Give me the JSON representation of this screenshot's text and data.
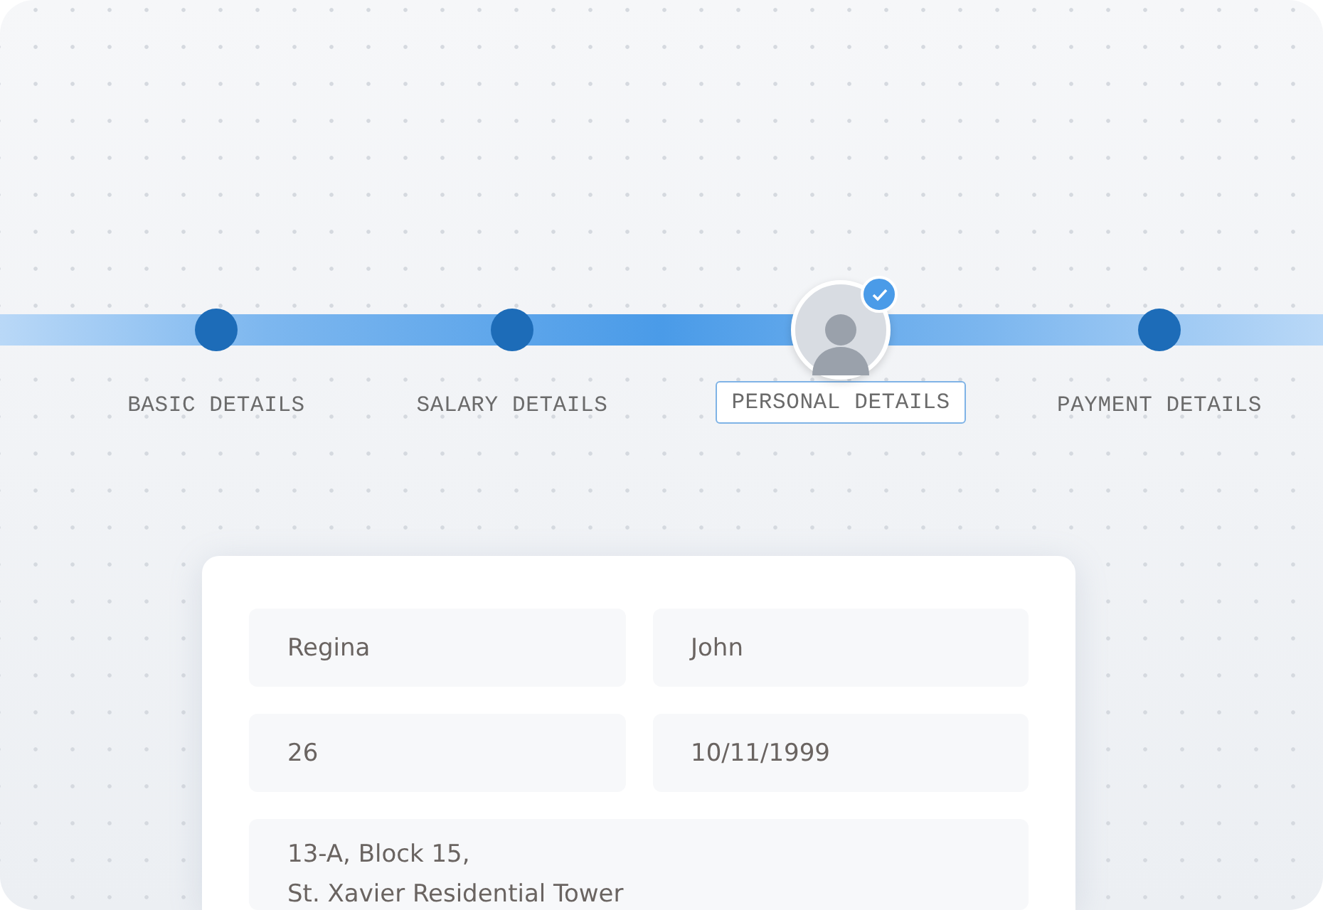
{
  "steps": [
    {
      "label": "BASIC DETAILS",
      "kind": "dot",
      "selected": false
    },
    {
      "label": "SALARY DETAILS",
      "kind": "dot",
      "selected": false
    },
    {
      "label": "PERSONAL DETAILS",
      "kind": "avatar",
      "selected": true
    },
    {
      "label": "PAYMENT DETAILS",
      "kind": "dot",
      "selected": false
    }
  ],
  "form": {
    "fields": [
      {
        "value": "Regina",
        "kind": "half"
      },
      {
        "value": "John",
        "kind": "half"
      },
      {
        "value": "26",
        "kind": "half"
      },
      {
        "value": "10/11/1999",
        "kind": "half"
      },
      {
        "lines": [
          "13-A, Block 15,",
          "St. Xavier Residential Tower"
        ],
        "kind": "full"
      }
    ]
  }
}
